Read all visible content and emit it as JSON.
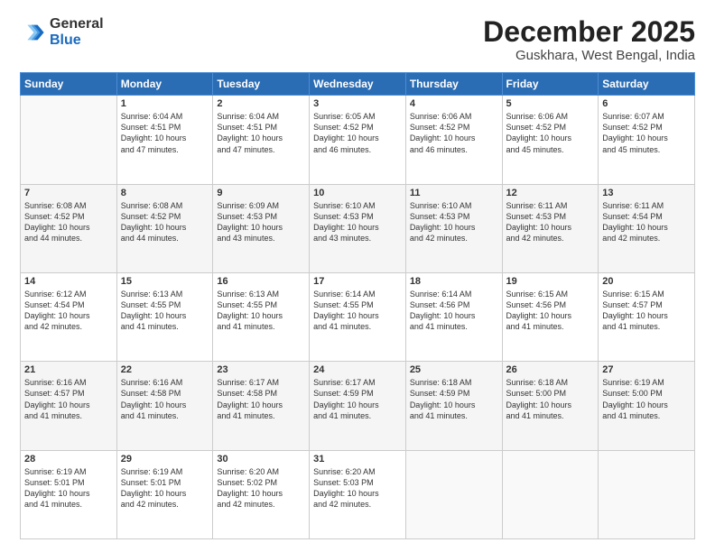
{
  "logo": {
    "general": "General",
    "blue": "Blue"
  },
  "header": {
    "month": "December 2025",
    "location": "Guskhara, West Bengal, India"
  },
  "weekdays": [
    "Sunday",
    "Monday",
    "Tuesday",
    "Wednesday",
    "Thursday",
    "Friday",
    "Saturday"
  ],
  "weeks": [
    [
      {
        "day": "",
        "info": ""
      },
      {
        "day": "1",
        "info": "Sunrise: 6:04 AM\nSunset: 4:51 PM\nDaylight: 10 hours\nand 47 minutes."
      },
      {
        "day": "2",
        "info": "Sunrise: 6:04 AM\nSunset: 4:51 PM\nDaylight: 10 hours\nand 47 minutes."
      },
      {
        "day": "3",
        "info": "Sunrise: 6:05 AM\nSunset: 4:52 PM\nDaylight: 10 hours\nand 46 minutes."
      },
      {
        "day": "4",
        "info": "Sunrise: 6:06 AM\nSunset: 4:52 PM\nDaylight: 10 hours\nand 46 minutes."
      },
      {
        "day": "5",
        "info": "Sunrise: 6:06 AM\nSunset: 4:52 PM\nDaylight: 10 hours\nand 45 minutes."
      },
      {
        "day": "6",
        "info": "Sunrise: 6:07 AM\nSunset: 4:52 PM\nDaylight: 10 hours\nand 45 minutes."
      }
    ],
    [
      {
        "day": "7",
        "info": "Sunrise: 6:08 AM\nSunset: 4:52 PM\nDaylight: 10 hours\nand 44 minutes."
      },
      {
        "day": "8",
        "info": "Sunrise: 6:08 AM\nSunset: 4:52 PM\nDaylight: 10 hours\nand 44 minutes."
      },
      {
        "day": "9",
        "info": "Sunrise: 6:09 AM\nSunset: 4:53 PM\nDaylight: 10 hours\nand 43 minutes."
      },
      {
        "day": "10",
        "info": "Sunrise: 6:10 AM\nSunset: 4:53 PM\nDaylight: 10 hours\nand 43 minutes."
      },
      {
        "day": "11",
        "info": "Sunrise: 6:10 AM\nSunset: 4:53 PM\nDaylight: 10 hours\nand 42 minutes."
      },
      {
        "day": "12",
        "info": "Sunrise: 6:11 AM\nSunset: 4:53 PM\nDaylight: 10 hours\nand 42 minutes."
      },
      {
        "day": "13",
        "info": "Sunrise: 6:11 AM\nSunset: 4:54 PM\nDaylight: 10 hours\nand 42 minutes."
      }
    ],
    [
      {
        "day": "14",
        "info": "Sunrise: 6:12 AM\nSunset: 4:54 PM\nDaylight: 10 hours\nand 42 minutes."
      },
      {
        "day": "15",
        "info": "Sunrise: 6:13 AM\nSunset: 4:55 PM\nDaylight: 10 hours\nand 41 minutes."
      },
      {
        "day": "16",
        "info": "Sunrise: 6:13 AM\nSunset: 4:55 PM\nDaylight: 10 hours\nand 41 minutes."
      },
      {
        "day": "17",
        "info": "Sunrise: 6:14 AM\nSunset: 4:55 PM\nDaylight: 10 hours\nand 41 minutes."
      },
      {
        "day": "18",
        "info": "Sunrise: 6:14 AM\nSunset: 4:56 PM\nDaylight: 10 hours\nand 41 minutes."
      },
      {
        "day": "19",
        "info": "Sunrise: 6:15 AM\nSunset: 4:56 PM\nDaylight: 10 hours\nand 41 minutes."
      },
      {
        "day": "20",
        "info": "Sunrise: 6:15 AM\nSunset: 4:57 PM\nDaylight: 10 hours\nand 41 minutes."
      }
    ],
    [
      {
        "day": "21",
        "info": "Sunrise: 6:16 AM\nSunset: 4:57 PM\nDaylight: 10 hours\nand 41 minutes."
      },
      {
        "day": "22",
        "info": "Sunrise: 6:16 AM\nSunset: 4:58 PM\nDaylight: 10 hours\nand 41 minutes."
      },
      {
        "day": "23",
        "info": "Sunrise: 6:17 AM\nSunset: 4:58 PM\nDaylight: 10 hours\nand 41 minutes."
      },
      {
        "day": "24",
        "info": "Sunrise: 6:17 AM\nSunset: 4:59 PM\nDaylight: 10 hours\nand 41 minutes."
      },
      {
        "day": "25",
        "info": "Sunrise: 6:18 AM\nSunset: 4:59 PM\nDaylight: 10 hours\nand 41 minutes."
      },
      {
        "day": "26",
        "info": "Sunrise: 6:18 AM\nSunset: 5:00 PM\nDaylight: 10 hours\nand 41 minutes."
      },
      {
        "day": "27",
        "info": "Sunrise: 6:19 AM\nSunset: 5:00 PM\nDaylight: 10 hours\nand 41 minutes."
      }
    ],
    [
      {
        "day": "28",
        "info": "Sunrise: 6:19 AM\nSunset: 5:01 PM\nDaylight: 10 hours\nand 41 minutes."
      },
      {
        "day": "29",
        "info": "Sunrise: 6:19 AM\nSunset: 5:01 PM\nDaylight: 10 hours\nand 42 minutes."
      },
      {
        "day": "30",
        "info": "Sunrise: 6:20 AM\nSunset: 5:02 PM\nDaylight: 10 hours\nand 42 minutes."
      },
      {
        "day": "31",
        "info": "Sunrise: 6:20 AM\nSunset: 5:03 PM\nDaylight: 10 hours\nand 42 minutes."
      },
      {
        "day": "",
        "info": ""
      },
      {
        "day": "",
        "info": ""
      },
      {
        "day": "",
        "info": ""
      }
    ]
  ]
}
